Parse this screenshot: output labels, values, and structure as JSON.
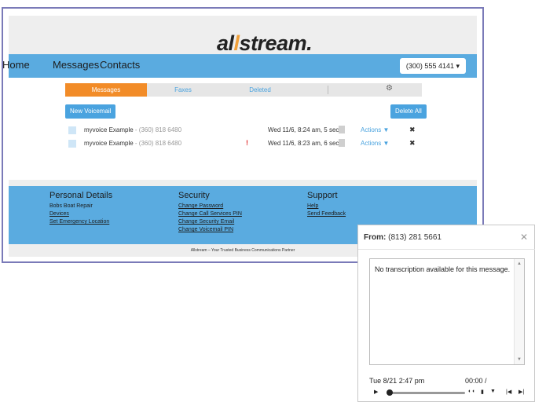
{
  "logo": {
    "text_pre": "al",
    "text_mark": "l",
    "text_post": "stream."
  },
  "nav": {
    "items": [
      "Home",
      "Messages",
      "Contacts"
    ],
    "phone": "(300) 555 4141 ▾"
  },
  "tabs": [
    "Messages",
    "Faxes",
    "Deleted"
  ],
  "buttons": {
    "new_voicemail": "New Voicemail",
    "delete_all": "Delete All"
  },
  "icons": {
    "gear": "gear-icon",
    "document": "document-icon",
    "delete": "close-icon",
    "warning": "warning-icon",
    "play": "play-icon"
  },
  "messages": [
    {
      "name": "myvoice Example",
      "number": " - (360) 818 6480",
      "date": "Wed 11/6, 8:24 am, 5 secs",
      "actions": "Actions ▼",
      "warning": ""
    },
    {
      "name": "myvoice Example",
      "number": " - (360) 818 6480",
      "date": "Wed 11/6, 8:23 am, 6 secs",
      "actions": "Actions ▼",
      "warning": "!"
    }
  ],
  "footer": {
    "personal": {
      "heading": "Personal Details",
      "name": "Bobs Boat Repair",
      "links": [
        "Devices",
        "Set Emergency Location"
      ]
    },
    "security": {
      "heading": "Security",
      "links": [
        "Change Password",
        "Change Call Services PIN",
        "Change Security Email",
        "Change Voicemail PIN"
      ]
    },
    "support": {
      "heading": "Support",
      "links": [
        "Help",
        "Send Feedback"
      ]
    }
  },
  "tagline": "Allstream – Your Trusted Business Communications Partner",
  "modal": {
    "from_label": "From:",
    "from_number": " (813) 281 5661",
    "transcription": "No transcription available for this message.",
    "date": "Tue 8/21 2:47 pm",
    "time": "00:00 /",
    "progress": 0.02
  },
  "colors": {
    "nav_blue": "#5aabe0",
    "accent_orange": "#f28c28",
    "link_blue": "#4aa3df",
    "frame": "#7a7ab8"
  }
}
